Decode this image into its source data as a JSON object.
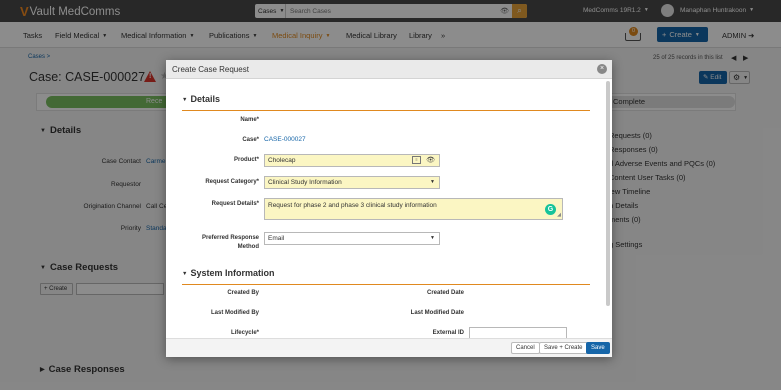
{
  "topbar": {
    "logo_text": "Vault MedComms",
    "search_scope": "Cases",
    "search_placeholder": "Search Cases",
    "vault_name": "MedComms 19R1.2",
    "user_name": "Manaphan Huntrakoon"
  },
  "nav": {
    "items": [
      "Tasks",
      "Field Medical",
      "Medical Information",
      "Publications",
      "Medical Inquiry",
      "Medical Library",
      "Library"
    ],
    "inbox_count": "0",
    "create_label": "Create",
    "admin_label": "ADMIN"
  },
  "page": {
    "breadcrumb": "Cases >",
    "title": "Case: CASE-000027",
    "pager_text": "25 of 25 records in this list",
    "edit_label": "Edit",
    "progress_left": "Rece",
    "progress_right": "Complete",
    "details_title": "Details",
    "fields": [
      {
        "label": "Case Contact",
        "value": "Carme"
      },
      {
        "label": "Requestor",
        "value": ""
      },
      {
        "label": "Origination Channel",
        "value": "Call Ce"
      },
      {
        "label": "Priority",
        "value": "Standa"
      }
    ],
    "case_requests_title": "Case Requests",
    "cr_create": "Create",
    "case_responses_title": "Case Responses",
    "side_items": [
      "Requests (0)",
      "Responses (0)",
      "d Adverse Events and PQCs (0)",
      "Content User Tasks (0)",
      "iew Timeline",
      "n Details",
      "ments (0)",
      "g Settings"
    ]
  },
  "modal": {
    "title": "Create Case Request",
    "details_title": "Details",
    "name_label": "Name*",
    "case_label": "Case*",
    "case_value": "CASE-000027",
    "product_label": "Product*",
    "product_value": "Cholecap",
    "category_label": "Request Category*",
    "category_value": "Clinical Study Information",
    "details_label": "Request Details*",
    "details_value": "Request for phase 2 and phase 3 clinical study information",
    "method_label_1": "Preferred Response",
    "method_label_2": "Method",
    "method_value": "Email",
    "sysinfo_title": "System Information",
    "created_by": "Created By",
    "created_date": "Created Date",
    "last_mod_by": "Last Modified By",
    "last_mod_date": "Last Modified Date",
    "lifecycle": "Lifecycle*",
    "external_id": "External ID",
    "cancel": "Cancel",
    "save_create": "Save + Create",
    "save": "Save"
  }
}
